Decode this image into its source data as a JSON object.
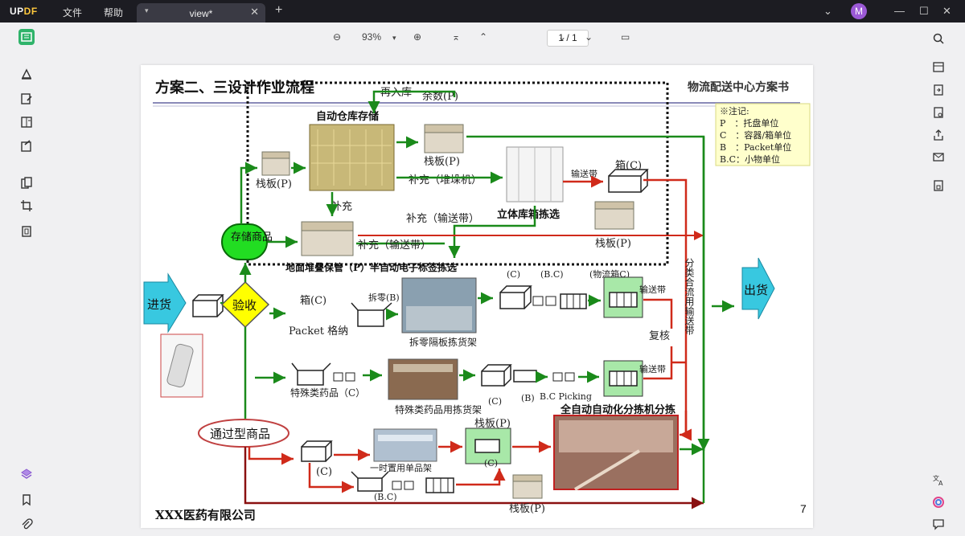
{
  "app": {
    "logo_a": "UP",
    "logo_b": "DF",
    "menu_file": "文件",
    "menu_help": "帮助",
    "tab_title": "view*",
    "avatar": "M"
  },
  "toolbar": {
    "zoom": "93%",
    "page": "1 / 1"
  },
  "slide": {
    "title": "方案二、三设计作业流程",
    "header_right": "物流配送中心方案书",
    "note_title": "※注记:",
    "note_lines": [
      "P　：托盘单位",
      "C　：容器/箱单位",
      "B　：Packet单位",
      "B.C：小物单位"
    ],
    "auto_storage": "自动仓库存储",
    "reentry": "再入库",
    "remain_p": "余数(P)",
    "pallet_p": "栈板(P)",
    "replenish": "补充",
    "replenish_stacker": "补充（堆垛机）",
    "replenish_conveyor": "补充（输送带）",
    "cube_pick": "立体库箱拣选",
    "conveyor": "输送带",
    "box_c": "箱(C)",
    "storage_goods": "存储商品",
    "floor_stack": "地面堆叠保管（P）半自动电子标签拣选",
    "inbound": "进货",
    "inspect": "验收",
    "packet_store": "Packet 格纳",
    "split_b": "拆零(B)",
    "split_shelf": "拆零隔板拣货架",
    "c_label": "(C)",
    "bc_label": "(B.C)",
    "logistics_box": "(物流箱C)",
    "sort_conveyor": "分类合流用输送带",
    "outbound": "出货",
    "recheck": "复核",
    "special_drug": "特殊类药品（C）",
    "special_shelf": "特殊类药品用拣货架",
    "b_label": "(B)",
    "bc_picking": "B.C Picking",
    "auto_sorter": "全自动自动化分拣机分拣",
    "pass_goods": "通过型商品",
    "temp_shelf": "一时置用单品架",
    "company": "XXX医药有限公司",
    "page_no": "7"
  },
  "colors": {
    "green": "#1a8a1a",
    "red": "#d02a1a",
    "darkred": "#8a1010",
    "cyan": "#38c8e0",
    "yellow": "#ffff00"
  }
}
